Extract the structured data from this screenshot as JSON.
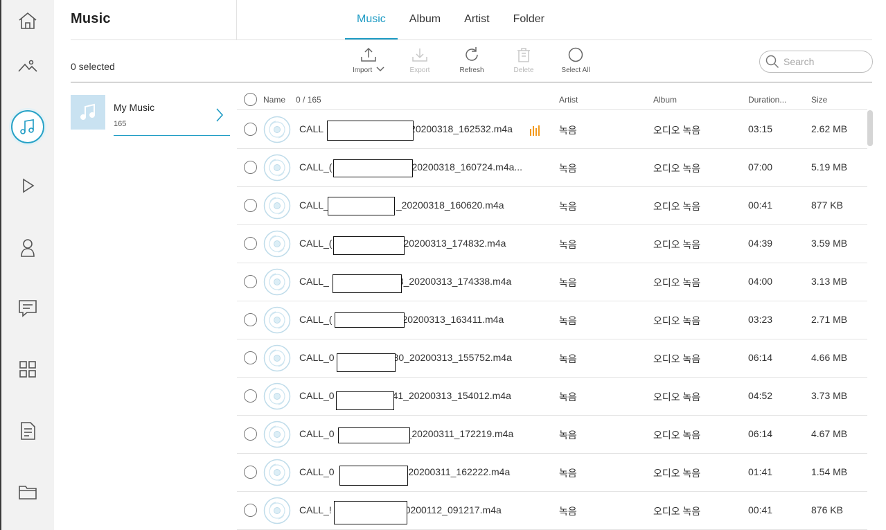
{
  "app": {
    "title": "Music"
  },
  "rail": {
    "items": [
      {
        "icon": "home-icon"
      },
      {
        "icon": "photos-icon"
      },
      {
        "icon": "music-icon",
        "active": true
      },
      {
        "icon": "video-icon"
      },
      {
        "icon": "contacts-icon"
      },
      {
        "icon": "messages-icon"
      },
      {
        "icon": "apps-icon"
      },
      {
        "icon": "documents-icon"
      },
      {
        "icon": "folder-icon"
      }
    ]
  },
  "tabs": [
    {
      "label": "Music",
      "active": true
    },
    {
      "label": "Album"
    },
    {
      "label": "Artist"
    },
    {
      "label": "Folder"
    }
  ],
  "selection": {
    "label": "0 selected"
  },
  "toolbar": {
    "import": "Import",
    "export": "Export",
    "refresh": "Refresh",
    "delete": "Delete",
    "select_all": "Select All"
  },
  "search": {
    "placeholder": "Search",
    "value": ""
  },
  "playlist": {
    "name": "My Music",
    "count": "165"
  },
  "table": {
    "headers": {
      "name": "Name",
      "count": "0 / 165",
      "artist": "Artist",
      "album": "Album",
      "duration": "Duration...",
      "size": "Size"
    },
    "rows": [
      {
        "name_prefix": "CALL",
        "name_suffix": "20200318_162532.m4a",
        "artist": "녹음",
        "album": "오디오 녹음",
        "duration": "03:15",
        "size": "2.62 MB",
        "playing": true
      },
      {
        "name_prefix": "CALL_(",
        "name_suffix": "20200318_160724.m4a...",
        "artist": "녹음",
        "album": "오디오 녹음",
        "duration": "07:00",
        "size": "5.19 MB"
      },
      {
        "name_prefix": "CALL_",
        "name_suffix": "_20200318_160620.m4a",
        "artist": "녹음",
        "album": "오디오 녹음",
        "duration": "00:41",
        "size": "877 KB"
      },
      {
        "name_prefix": "CALL_(",
        "name_suffix": "20200313_174832.m4a",
        "artist": "녹음",
        "album": "오디오 녹음",
        "duration": "04:39",
        "size": "3.59 MB"
      },
      {
        "name_prefix": "CALL_",
        "name_suffix": "3_20200313_174338.m4a",
        "artist": "녹음",
        "album": "오디오 녹음",
        "duration": "04:00",
        "size": "3.13 MB"
      },
      {
        "name_prefix": "CALL_(",
        "name_suffix": "20200313_163411.m4a",
        "artist": "녹음",
        "album": "오디오 녹음",
        "duration": "03:23",
        "size": "2.71 MB"
      },
      {
        "name_prefix": "CALL_0",
        "name_suffix": "30_20200313_155752.m4a",
        "artist": "녹음",
        "album": "오디오 녹음",
        "duration": "06:14",
        "size": "4.66 MB"
      },
      {
        "name_prefix": "CALL_0",
        "name_suffix": "41_20200313_154012.m4a",
        "artist": "녹음",
        "album": "오디오 녹음",
        "duration": "04:52",
        "size": "3.73 MB"
      },
      {
        "name_prefix": "CALL_0",
        "name_suffix": "_20200311_172219.m4a",
        "artist": "녹음",
        "album": "오디오 녹음",
        "duration": "06:14",
        "size": "4.67 MB"
      },
      {
        "name_prefix": "CALL_0",
        "name_suffix": "_20200311_162222.m4a",
        "artist": "녹음",
        "album": "오디오 녹음",
        "duration": "01:41",
        "size": "1.54 MB"
      },
      {
        "name_prefix": "CALL_!",
        "name_suffix": "0200112_091217.m4a",
        "artist": "녹음",
        "album": "오디오 녹음",
        "duration": "00:41",
        "size": "876 KB"
      }
    ]
  },
  "colors": {
    "accent": "#1d9bc4",
    "playing_bars": "#f39a1e",
    "thumb_bg": "#c9e2f1"
  }
}
